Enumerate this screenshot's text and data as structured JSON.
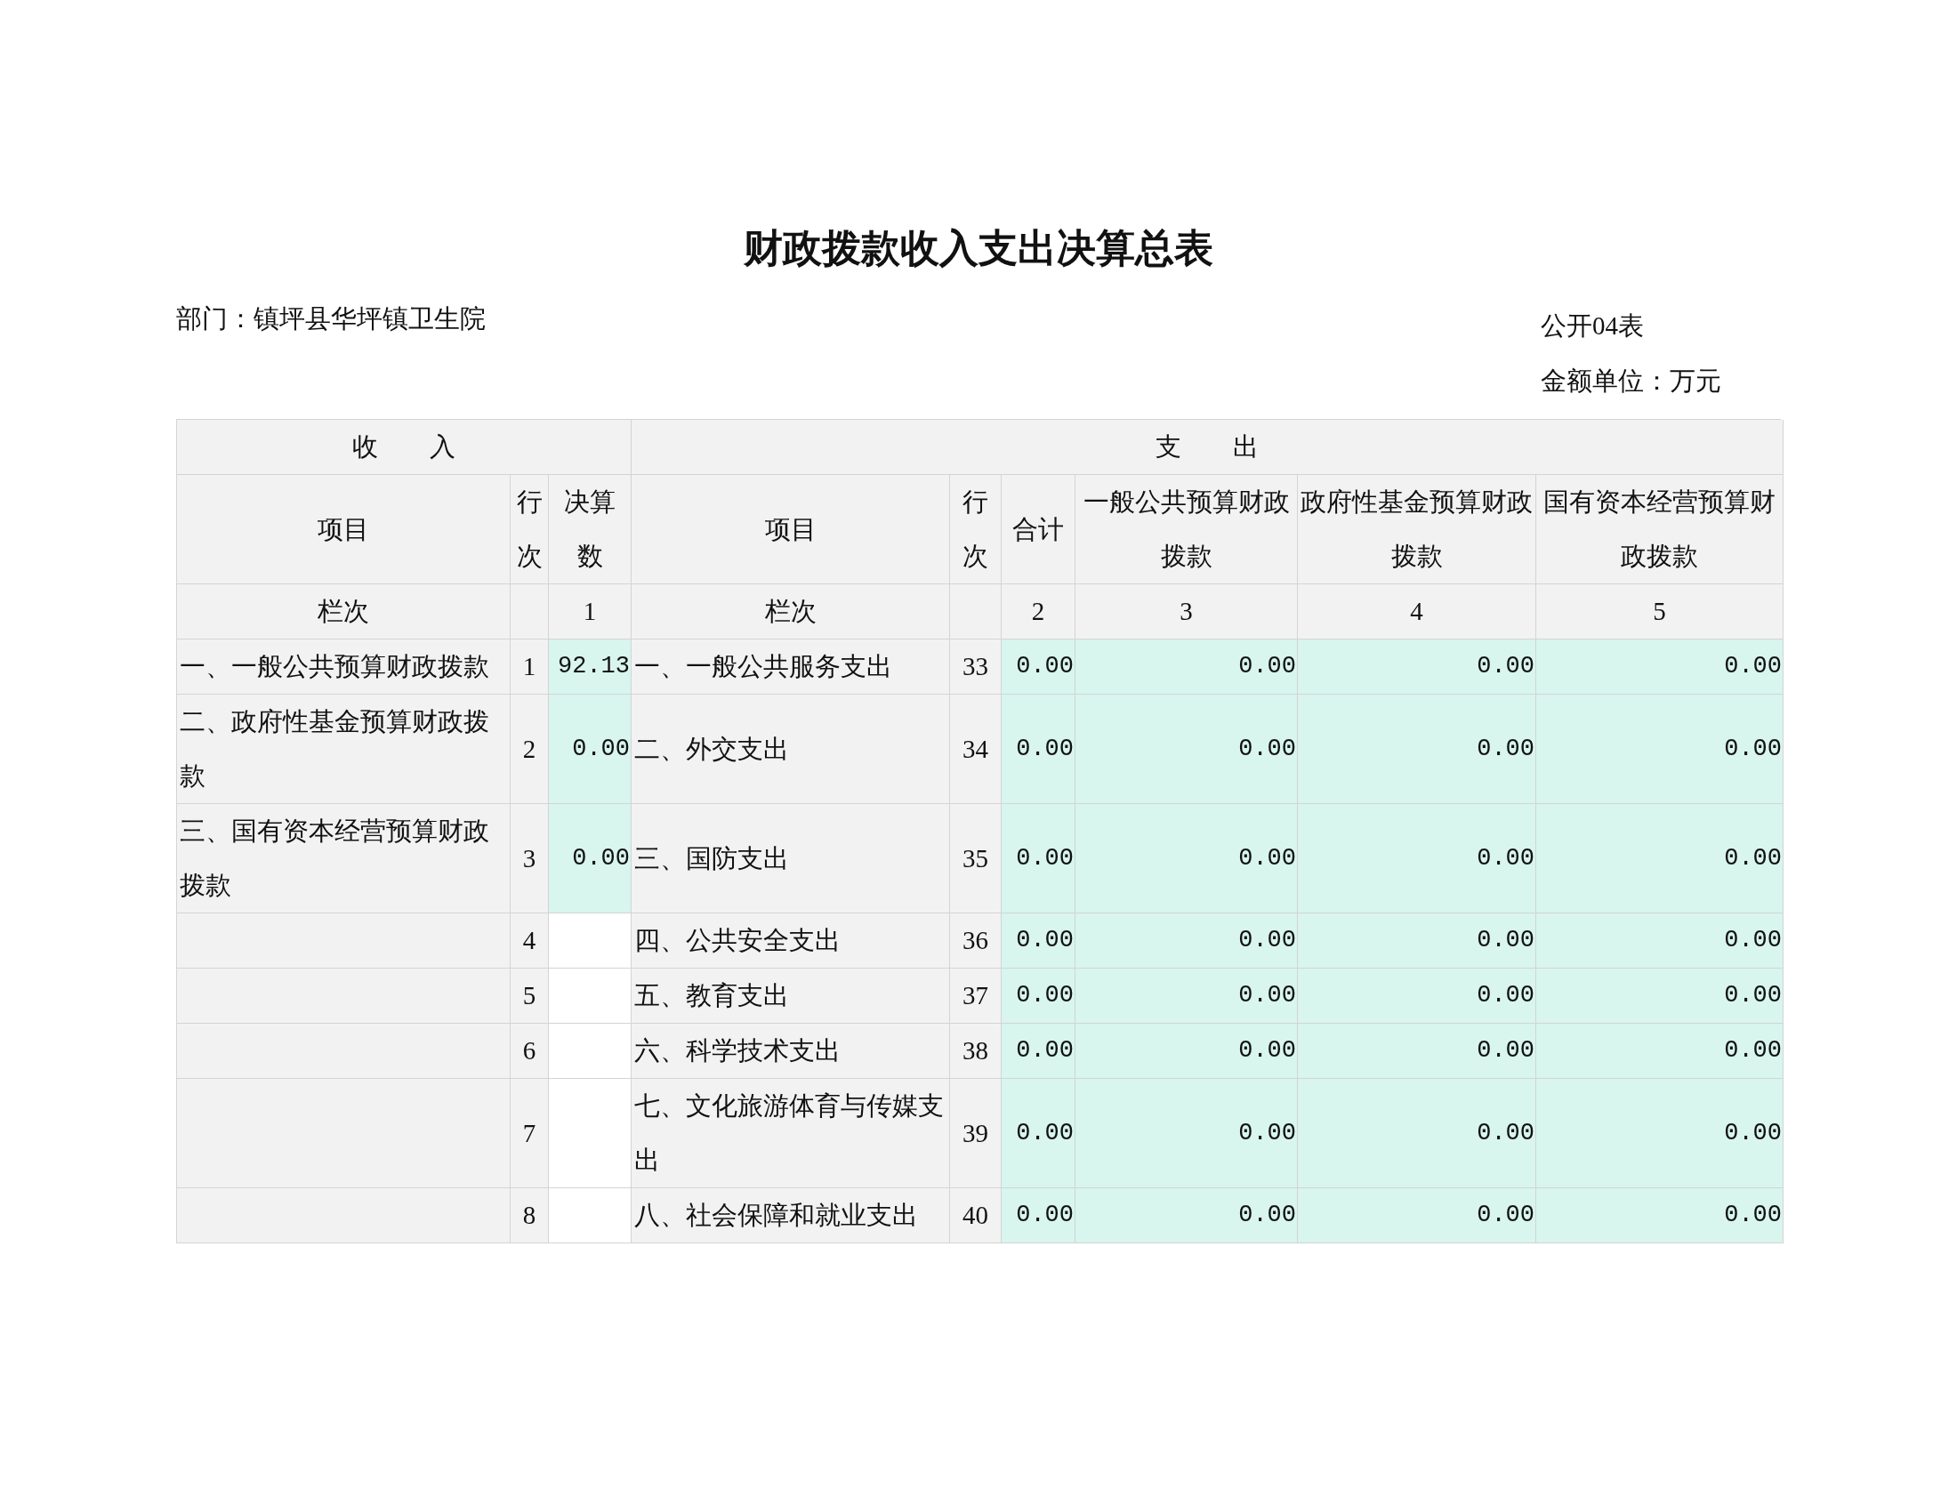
{
  "title": "财政拨款收入支出决算总表",
  "department": "部门：镇坪县华坪镇卫生院",
  "form_no": "公开04表",
  "unit": "金额单位：万元",
  "table": {
    "group_headers": [
      "收　　入",
      "支　　出"
    ],
    "columns": [
      "项目",
      "行次",
      "决算数",
      "项目",
      "行次",
      "合计",
      "一般公共预算财政拨款",
      "政府性基金预算财政拨款",
      "国有资本经营预算财政拨款"
    ],
    "index_row": {
      "income_label": "栏次",
      "income_amount": "1",
      "expense_label": "栏次",
      "expense_values": [
        "2",
        "3",
        "4",
        "5"
      ]
    },
    "rows": [
      {
        "line": "1",
        "income_item": "一、一般公共预算财政拨款",
        "income_amount": "92.13",
        "expense_item": "一、一般公共服务支出",
        "expense_line": "33",
        "expense_values": [
          "0.00",
          "0.00",
          "0.00",
          "0.00"
        ]
      },
      {
        "line": "2",
        "income_item": "二、政府性基金预算财政拨款",
        "income_amount": "0.00",
        "expense_item": "二、外交支出",
        "expense_line": "34",
        "expense_values": [
          "0.00",
          "0.00",
          "0.00",
          "0.00"
        ]
      },
      {
        "line": "3",
        "income_item": "三、国有资本经营预算财政拨款",
        "income_amount": "0.00",
        "expense_item": "三、国防支出",
        "expense_line": "35",
        "expense_values": [
          "0.00",
          "0.00",
          "0.00",
          "0.00"
        ]
      },
      {
        "line": "4",
        "expense_item": "四、公共安全支出",
        "expense_line": "36",
        "expense_values": [
          "0.00",
          "0.00",
          "0.00",
          "0.00"
        ]
      },
      {
        "line": "5",
        "expense_item": "五、教育支出",
        "expense_line": "37",
        "expense_values": [
          "0.00",
          "0.00",
          "0.00",
          "0.00"
        ]
      },
      {
        "line": "6",
        "expense_item": "六、科学技术支出",
        "expense_line": "38",
        "expense_values": [
          "0.00",
          "0.00",
          "0.00",
          "0.00"
        ]
      },
      {
        "line": "7",
        "expense_item": "七、文化旅游体育与传媒支出",
        "expense_line": "39",
        "expense_values": [
          "0.00",
          "0.00",
          "0.00",
          "0.00"
        ]
      },
      {
        "line": "8",
        "expense_item": "八、社会保障和就业支出",
        "expense_line": "40",
        "expense_values": [
          "0.00",
          "0.00",
          "0.00",
          "0.00"
        ]
      }
    ]
  }
}
